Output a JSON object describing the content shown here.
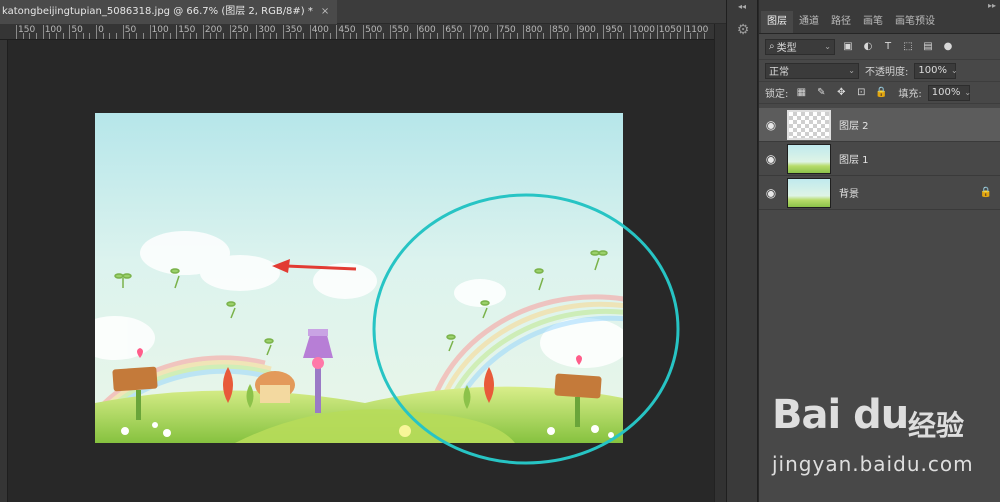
{
  "document": {
    "tab_title": "katongbeijingtupian_5086318.jpg @ 66.7% (图层 2, RGB/8#) *",
    "close_glyph": "×"
  },
  "ruler": {
    "labels": [
      "150",
      "100",
      "50",
      "0",
      "50",
      "100",
      "150",
      "200",
      "250",
      "300",
      "350",
      "400",
      "450",
      "500",
      "550",
      "600",
      "650",
      "700",
      "750",
      "800",
      "850",
      "900",
      "950",
      "1000",
      "1050",
      "1100"
    ]
  },
  "panel": {
    "tabs": [
      "图层",
      "通道",
      "路径",
      "画笔",
      "画笔预设"
    ],
    "active_tab": "图层",
    "filter_kind": "类型",
    "blend_mode": "正常",
    "opacity_label": "不透明度:",
    "opacity_value": "100%",
    "lock_label": "锁定:",
    "fill_label": "填充:",
    "fill_value": "100%",
    "filter_icons": [
      "image-filter-icon",
      "adjustment-filter-icon",
      "type-filter-icon",
      "shape-filter-icon",
      "smart-object-filter-icon",
      "filter-toggle-icon"
    ],
    "lock_icons": [
      "lock-transparent-icon",
      "lock-paint-icon",
      "lock-position-icon",
      "lock-artboard-icon",
      "lock-all-icon"
    ]
  },
  "layers": [
    {
      "name": "图层 2",
      "active": true,
      "thumb": "transparent",
      "locked": false
    },
    {
      "name": "图层 1",
      "active": false,
      "thumb": "scene",
      "locked": false
    },
    {
      "name": "背景",
      "active": false,
      "thumb": "scene",
      "locked": true
    }
  ],
  "annotations": {
    "arrow_color": "#e23b33",
    "ellipse_color": "#27c4c4"
  },
  "watermark": {
    "logo": "Bai du",
    "brand_cn": "经验",
    "url": "jingyan.baidu.com"
  }
}
